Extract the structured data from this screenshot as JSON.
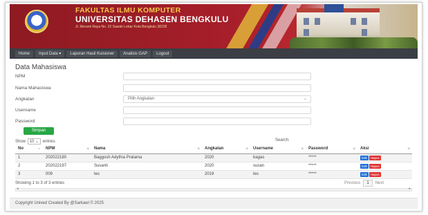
{
  "header": {
    "line1": "FAKULTAS ILMU KOMPUTER",
    "line2": "UNIVERSITAS DEHASEN BENGKULU",
    "address": "Jl. Meranti Raya No. 32 Sawah Lebar Kota Bengkulu 38228"
  },
  "nav": [
    "Home",
    "Input Data ▾",
    "Laporan Hasil Kuisioner",
    "Analisis GAP",
    "Logout"
  ],
  "form": {
    "title": "Data Mahasiswa",
    "npm_label": "NPM",
    "nama_label": "Nama Mahasiswa",
    "angkatan_label": "Angkatan",
    "angkatan_value": "Pilih Angkatan",
    "username_label": "Username",
    "password_label": "Password",
    "submit_label": "Simpan"
  },
  "table": {
    "show_prefix": "Show",
    "show_value": "10",
    "show_suffix": "entries",
    "search_label": "Search:",
    "columns": [
      "No",
      "NPM",
      "Nama",
      "Angkatan",
      "Username",
      "Password",
      "Aksi"
    ],
    "rows": [
      [
        "1",
        "202022180",
        "Baggosh Adythia Pratama",
        "2020",
        "bagas",
        "*****"
      ],
      [
        "2",
        "202022197",
        "Susanti",
        "2020",
        "susan",
        "*****"
      ],
      [
        "3",
        "009",
        "tes",
        "2019",
        "tes",
        "*****"
      ]
    ],
    "edit_label": "Edit",
    "delete_label": "Hapus",
    "info": "Showing 1 to 3 of 3 entries",
    "previous": "Previous",
    "page": "1",
    "next": "Next"
  },
  "footer": "Copyright Unived Created By @Sarkawi © 2025",
  "colors": {
    "banner": "#a71f2a",
    "nav": "#3b3e44",
    "accent": "#28a745",
    "edit": "#1e6fd9",
    "delete": "#e0312f"
  }
}
